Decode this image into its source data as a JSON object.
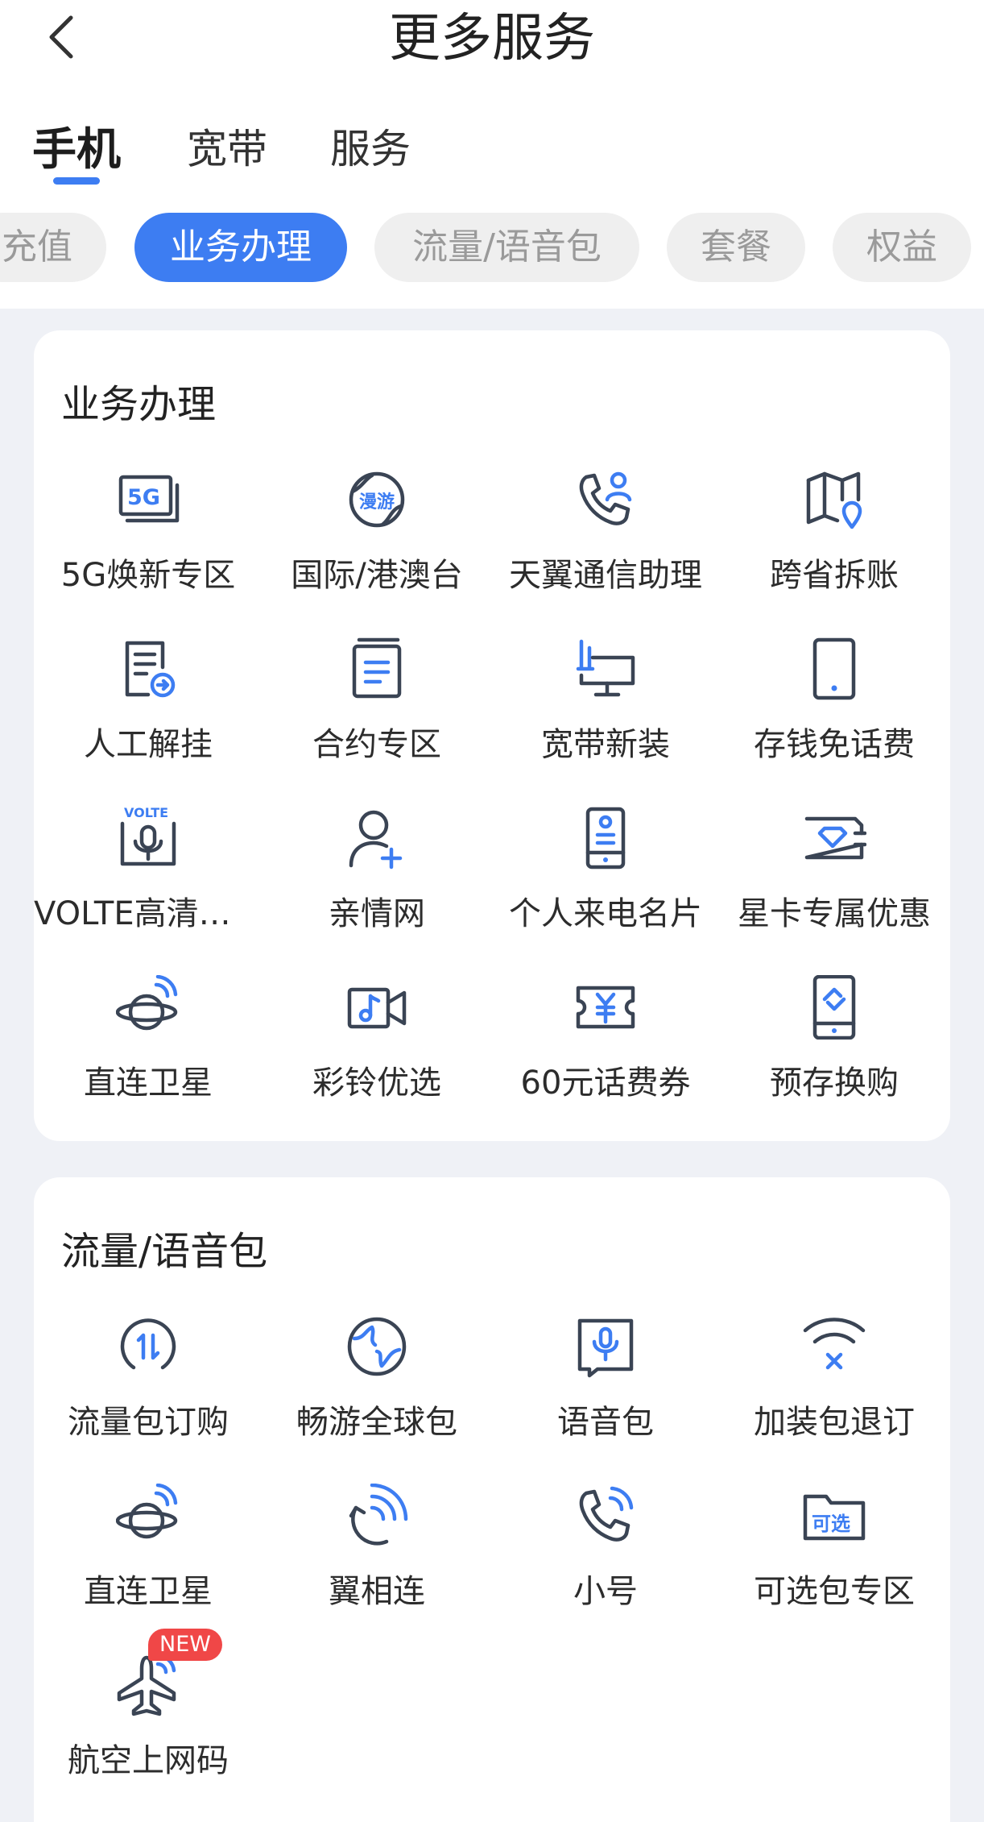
{
  "header": {
    "title": "更多服务"
  },
  "main_tabs": [
    {
      "label": "手机",
      "active": true
    },
    {
      "label": "宽带",
      "active": false
    },
    {
      "label": "服务",
      "active": false
    }
  ],
  "sub_tabs": [
    {
      "label": "充值",
      "active": false
    },
    {
      "label": "业务办理",
      "active": true
    },
    {
      "label": "流量/语音包",
      "active": false
    },
    {
      "label": "套餐",
      "active": false
    },
    {
      "label": "权益",
      "active": false
    }
  ],
  "section1": {
    "title": "业务办理",
    "items": [
      {
        "label": "5G焕新专区",
        "icon": "5g-card-icon"
      },
      {
        "label": "国际/港澳台",
        "icon": "globe-roaming-icon"
      },
      {
        "label": "天翼通信助理",
        "icon": "phone-assistant-icon"
      },
      {
        "label": "跨省拆账",
        "icon": "map-location-icon"
      },
      {
        "label": "人工解挂",
        "icon": "document-arrow-icon"
      },
      {
        "label": "合约专区",
        "icon": "contract-doc-icon"
      },
      {
        "label": "宽带新装",
        "icon": "broadband-monitor-icon"
      },
      {
        "label": "存钱免话费",
        "icon": "mobile-phone-icon"
      },
      {
        "label": "VOLTE高清语音",
        "icon": "volte-mic-icon"
      },
      {
        "label": "亲情网",
        "icon": "user-add-icon"
      },
      {
        "label": "个人来电名片",
        "icon": "phone-card-icon"
      },
      {
        "label": "星卡专属优惠",
        "icon": "diamond-sim-icon"
      },
      {
        "label": "直连卫星",
        "icon": "satellite-planet-icon"
      },
      {
        "label": "彩铃优选",
        "icon": "video-ringtone-icon"
      },
      {
        "label": "60元话费券",
        "icon": "yuan-coupon-icon"
      },
      {
        "label": "预存换购",
        "icon": "phone-exchange-icon"
      }
    ]
  },
  "section2": {
    "title": "流量/语音包",
    "items": [
      {
        "label": "流量包订购",
        "icon": "data-arrows-icon"
      },
      {
        "label": "畅游全球包",
        "icon": "globe-icon"
      },
      {
        "label": "语音包",
        "icon": "voice-mic-icon"
      },
      {
        "label": "加装包退订",
        "icon": "wifi-cancel-icon"
      },
      {
        "label": "直连卫星",
        "icon": "satellite-planet-icon"
      },
      {
        "label": "翼相连",
        "icon": "signal-sync-icon"
      },
      {
        "label": "小号",
        "icon": "phone-signal-icon"
      },
      {
        "label": "可选包专区",
        "icon": "optional-folder-icon"
      },
      {
        "label": "航空上网码",
        "icon": "airplane-wifi-icon",
        "badge": "NEW"
      }
    ]
  },
  "colors": {
    "accent": "#3d7df2",
    "badge": "#f04747",
    "background": "#eff1f6",
    "icon_stroke": "#3a4454"
  }
}
